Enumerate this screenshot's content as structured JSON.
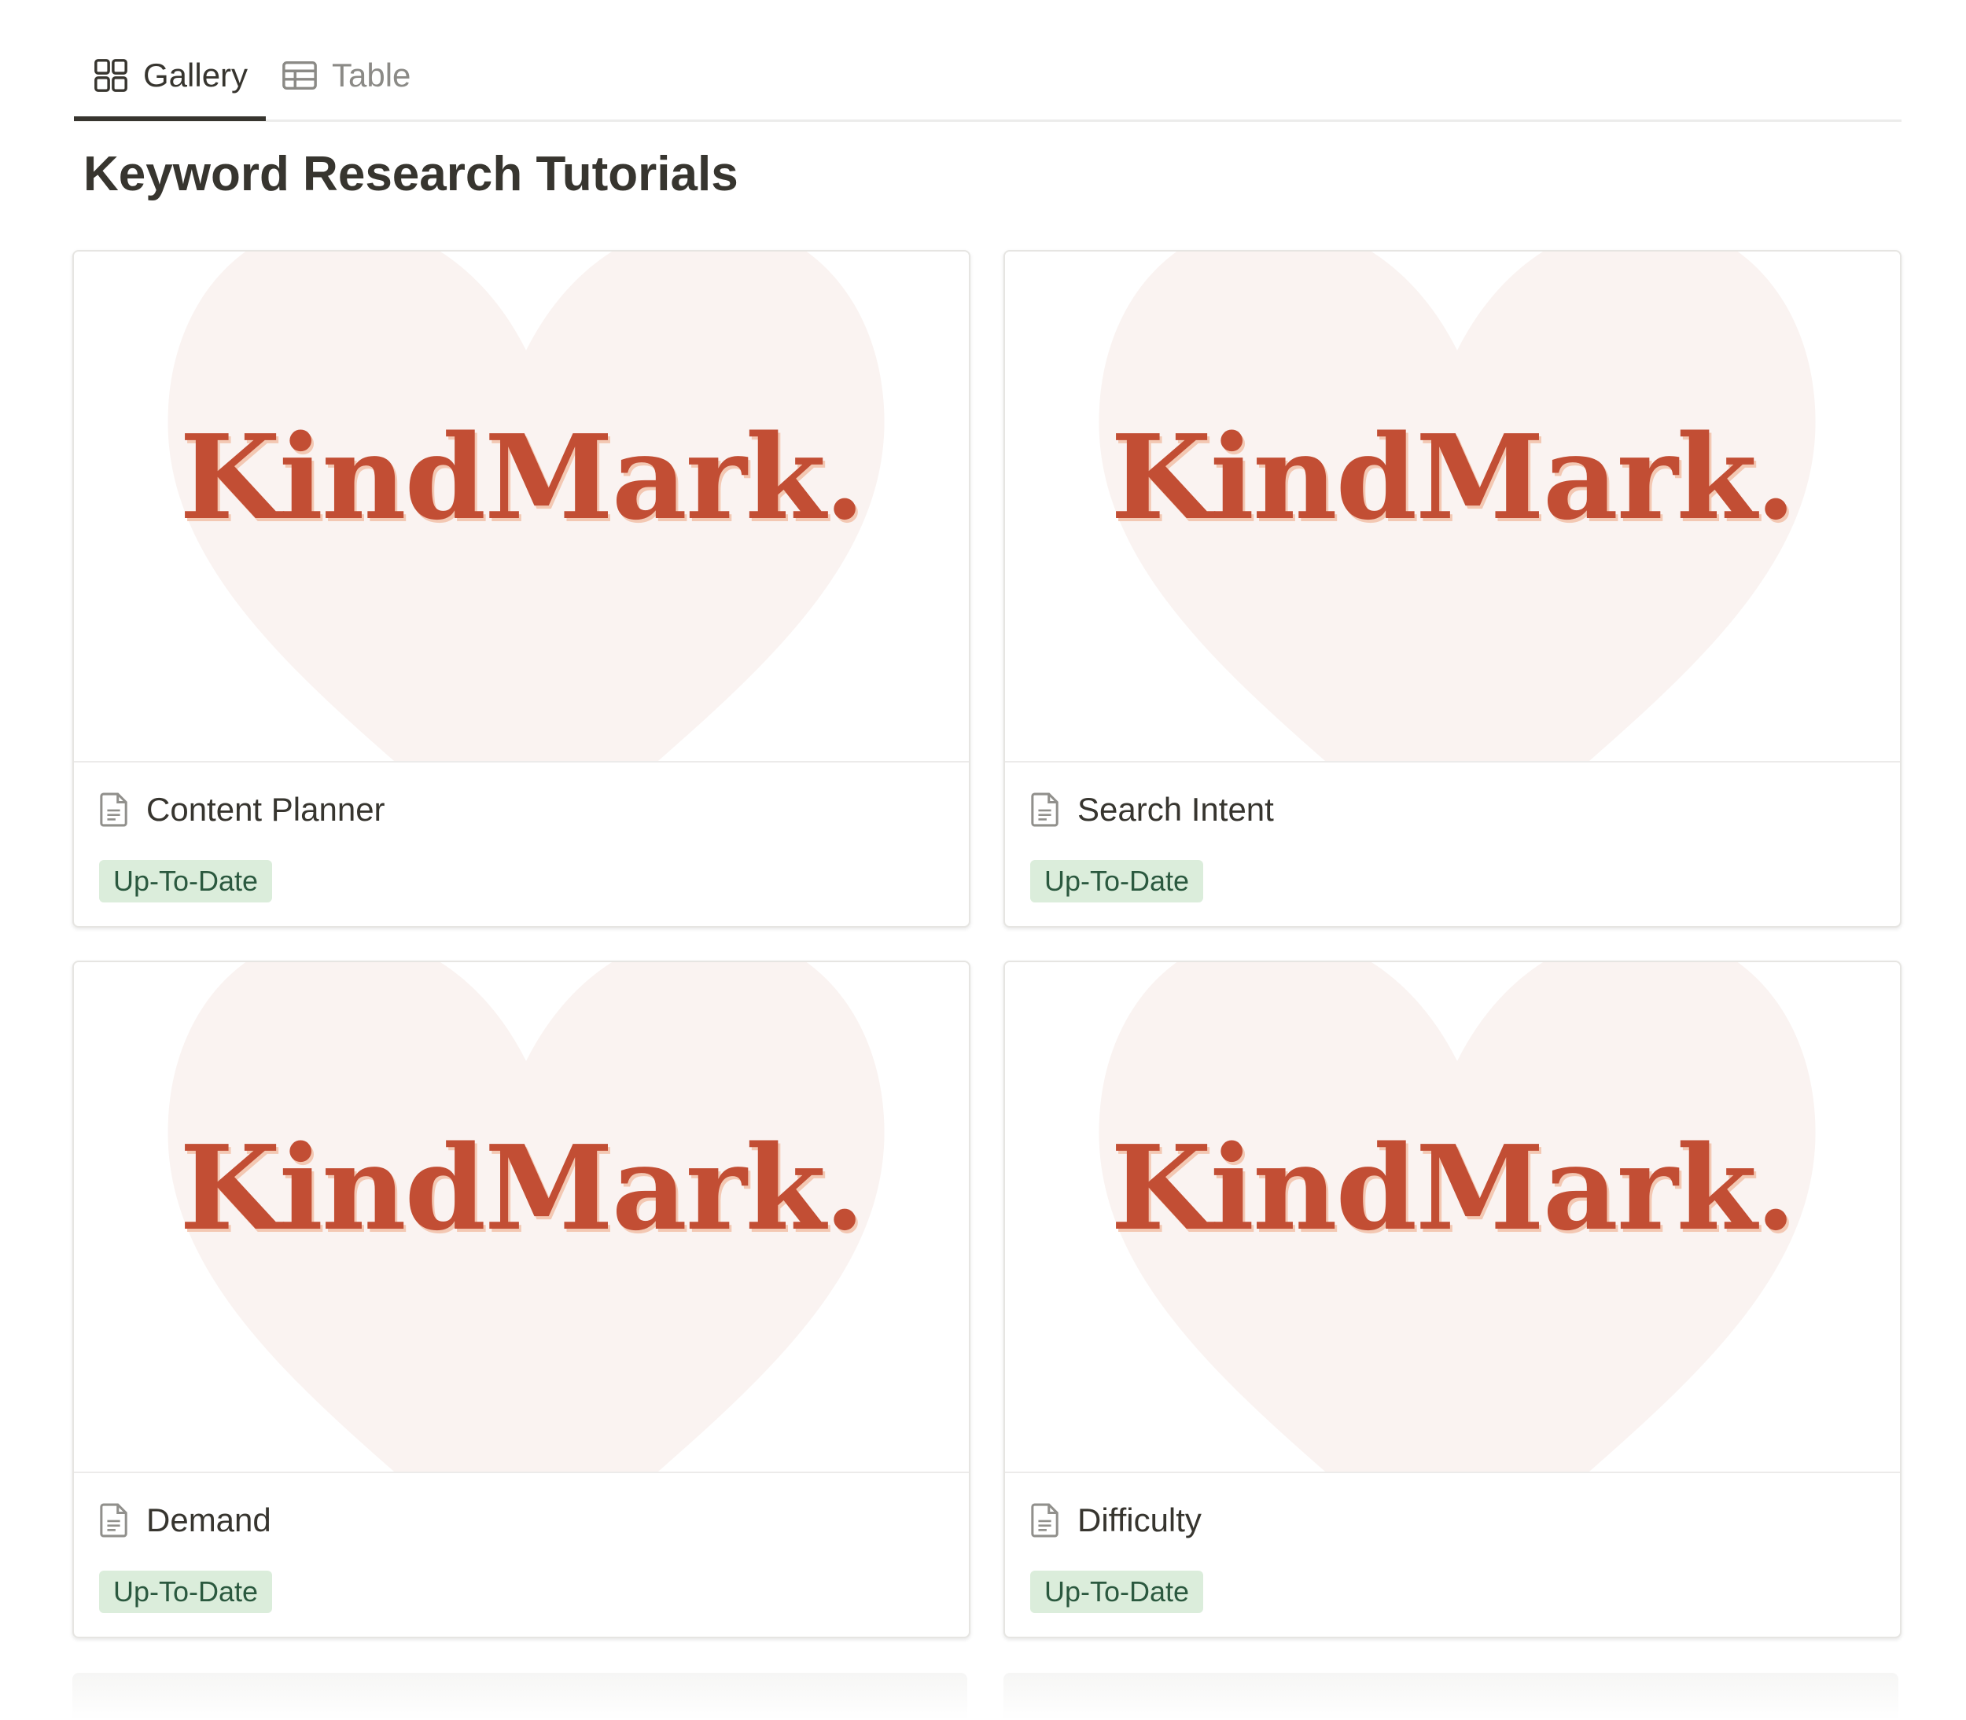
{
  "tabs": [
    {
      "label": "Gallery",
      "icon": "gallery-icon",
      "active": true
    },
    {
      "label": "Table",
      "icon": "table-icon",
      "active": false
    }
  ],
  "page_title": "Keyword Research Tutorials",
  "colors": {
    "brand_text": "#c24e34",
    "heart": "#faf3f1",
    "badge_bg": "#dbeddb",
    "badge_text": "#2b593f"
  },
  "cards": [
    {
      "cover_brand": "KindMark.",
      "title": "Content Planner",
      "status": "Up-To-Date",
      "icon": "page-icon"
    },
    {
      "cover_brand": "KindMark.",
      "title": "Search Intent",
      "status": "Up-To-Date",
      "icon": "page-icon"
    },
    {
      "cover_brand": "KindMark.",
      "title": "Demand",
      "status": "Up-To-Date",
      "icon": "page-icon"
    },
    {
      "cover_brand": "KindMark.",
      "title": "Difficulty",
      "status": "Up-To-Date",
      "icon": "page-icon"
    }
  ]
}
